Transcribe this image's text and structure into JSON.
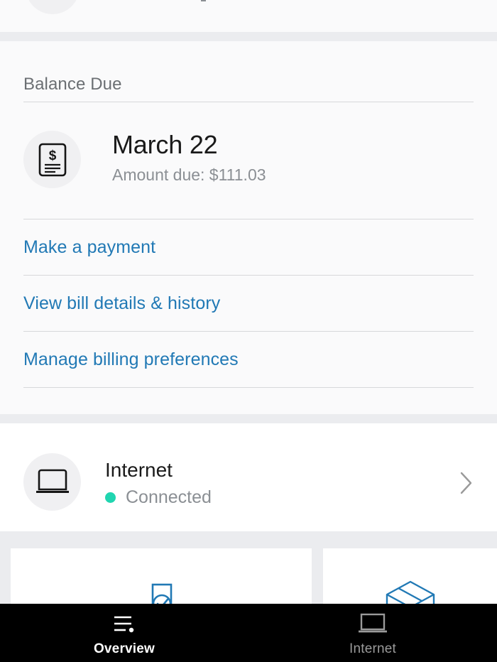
{
  "app": {
    "accent_blue": "#2179b5",
    "status_green": "#20d5b0",
    "band_gray": "#ebecef",
    "section_bg": "#fafafb"
  },
  "billing": {
    "title": "Balance Due",
    "bill_icon": "bill-dollar-document-icon",
    "due_date": "March 22",
    "amount_due": "Amount due: $111.03",
    "links": [
      {
        "label": "Make a payment",
        "name": "make-a-payment-link"
      },
      {
        "label": "View bill details & history",
        "name": "view-bill-details-history-link"
      },
      {
        "label": "Manage billing preferences",
        "name": "manage-billing-preferences-link"
      }
    ]
  },
  "service": {
    "icon": "laptop-icon",
    "name": "Internet",
    "status": "Connected",
    "chevron": "chevron-right-icon"
  },
  "cards": [
    {
      "icon": "document-check-icon"
    },
    {
      "icon": "package-box-icon"
    }
  ],
  "navbar": {
    "items": [
      {
        "label": "Overview",
        "icon": "list-lines-dot-icon",
        "active": true
      },
      {
        "label": "Internet",
        "icon": "laptop-icon",
        "active": false
      }
    ]
  }
}
